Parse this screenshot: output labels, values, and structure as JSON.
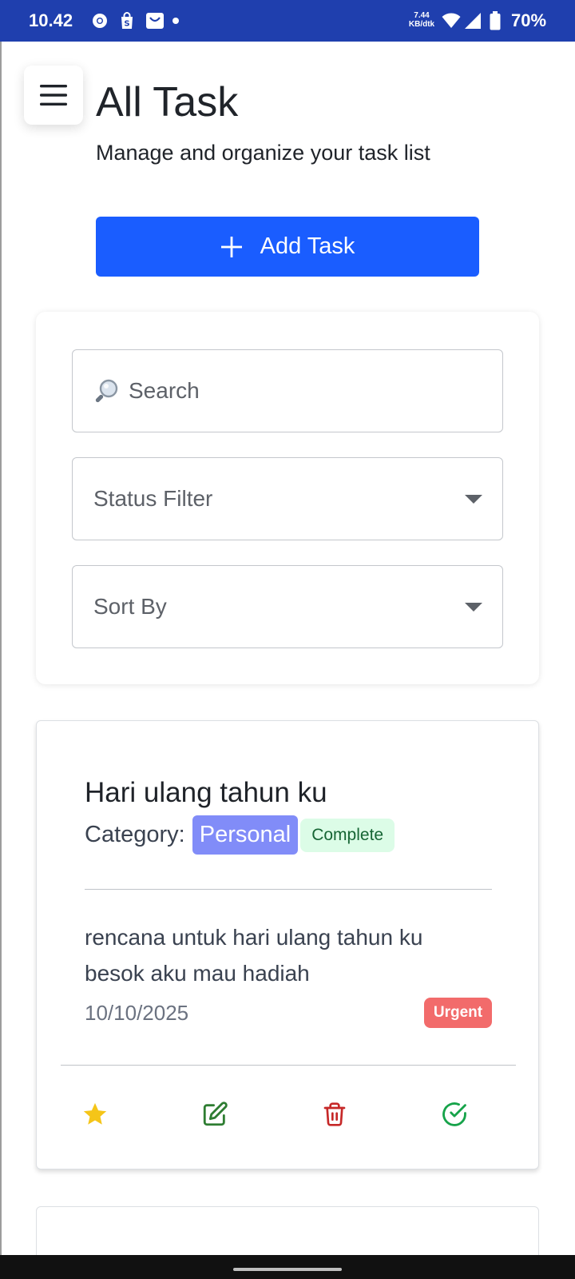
{
  "status_bar": {
    "time": "10.42",
    "speed_value": "7.44",
    "speed_unit": "KB/dtk",
    "battery": "70%",
    "icons": [
      "chrome-icon",
      "shopping-bag-icon",
      "mail-icon",
      "dot-icon",
      "wifi-icon",
      "signal-icon",
      "battery-icon"
    ]
  },
  "header": {
    "title": "All Task",
    "subtitle": "Manage and organize your task list",
    "add_button_label": "Add Task"
  },
  "filters": {
    "search_placeholder": "Search",
    "status_filter_label": "Status Filter",
    "sort_by_label": "Sort By"
  },
  "tasks": [
    {
      "title": "Hari ulang tahun ku",
      "category_label": "Category:",
      "category": "Personal",
      "status": "Complete",
      "description": "rencana untuk hari ulang tahun ku besok aku mau hadiah",
      "date": "10/10/2025",
      "priority": "Urgent",
      "actions": [
        "star-icon",
        "edit-icon",
        "trash-icon",
        "check-circle-icon"
      ]
    }
  ],
  "colors": {
    "status_bar": "#1f3fae",
    "primary": "#1a5dff",
    "category_badge": "#818cf8",
    "status_badge_bg": "#dcfce7",
    "status_badge_text": "#166534",
    "priority_badge": "#f26b6b",
    "star": "#f5c518",
    "edit": "#2e7d32",
    "delete": "#c62828",
    "complete": "#16a34a"
  }
}
